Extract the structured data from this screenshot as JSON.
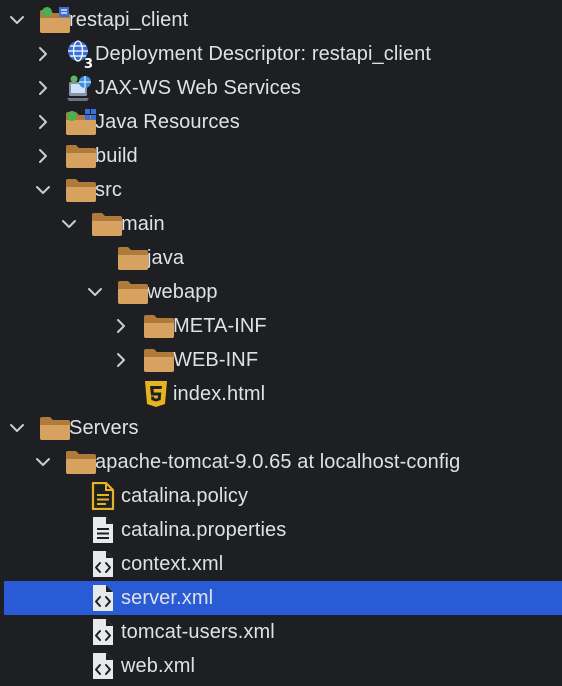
{
  "tree": {
    "rows": [
      {
        "name": "project-restapi-client",
        "label": "restapi_client",
        "depth": 0,
        "twisty": "down",
        "icon": "web-project-folder-icon"
      },
      {
        "name": "deployment-descriptor",
        "label": "Deployment Descriptor: restapi_client",
        "depth": 1,
        "twisty": "right",
        "icon": "deployment-descriptor-icon"
      },
      {
        "name": "jax-ws-web-services",
        "label": "JAX-WS Web Services",
        "depth": 1,
        "twisty": "right",
        "icon": "web-services-icon"
      },
      {
        "name": "java-resources",
        "label": "Java Resources",
        "depth": 1,
        "twisty": "right",
        "icon": "java-resources-icon"
      },
      {
        "name": "folder-build",
        "label": "build",
        "depth": 1,
        "twisty": "right",
        "icon": "folder-icon"
      },
      {
        "name": "folder-src",
        "label": "src",
        "depth": 1,
        "twisty": "down",
        "icon": "folder-icon"
      },
      {
        "name": "folder-main",
        "label": "main",
        "depth": 2,
        "twisty": "down",
        "icon": "folder-icon"
      },
      {
        "name": "folder-java",
        "label": "java",
        "depth": 3,
        "twisty": "none",
        "icon": "folder-icon"
      },
      {
        "name": "folder-webapp",
        "label": "webapp",
        "depth": 3,
        "twisty": "down",
        "icon": "folder-icon"
      },
      {
        "name": "folder-meta-inf",
        "label": "META-INF",
        "depth": 4,
        "twisty": "right",
        "icon": "folder-icon"
      },
      {
        "name": "folder-web-inf",
        "label": "WEB-INF",
        "depth": 4,
        "twisty": "right",
        "icon": "folder-icon"
      },
      {
        "name": "file-index-html",
        "label": "index.html",
        "depth": 4,
        "twisty": "none",
        "icon": "html5-icon"
      },
      {
        "name": "folder-servers",
        "label": "Servers",
        "depth": 0,
        "twisty": "down",
        "icon": "folder-icon"
      },
      {
        "name": "folder-apache-tomcat",
        "label": "apache-tomcat-9.0.65 at localhost-config",
        "depth": 1,
        "twisty": "down",
        "icon": "folder-icon"
      },
      {
        "name": "file-catalina-policy",
        "label": "catalina.policy",
        "depth": 2,
        "twisty": "none",
        "icon": "policy-file-icon"
      },
      {
        "name": "file-catalina-properties",
        "label": "catalina.properties",
        "depth": 2,
        "twisty": "none",
        "icon": "text-file-icon"
      },
      {
        "name": "file-context-xml",
        "label": "context.xml",
        "depth": 2,
        "twisty": "none",
        "icon": "xml-file-icon"
      },
      {
        "name": "file-server-xml",
        "label": "server.xml",
        "depth": 2,
        "twisty": "none",
        "icon": "xml-file-icon",
        "selected": true
      },
      {
        "name": "file-tomcat-users-xml",
        "label": "tomcat-users.xml",
        "depth": 2,
        "twisty": "none",
        "icon": "xml-file-icon"
      },
      {
        "name": "file-web-xml",
        "label": "web.xml",
        "depth": 2,
        "twisty": "none",
        "icon": "xml-file-icon"
      }
    ]
  },
  "colors": {
    "background": "#1e1f22",
    "text": "#dfe1e5",
    "selection": "#2a5bd6",
    "folder": "#d7a15f",
    "folder_dark": "#b07a3c",
    "html5": "#e6b422",
    "twisty": "#c9ccd1"
  }
}
